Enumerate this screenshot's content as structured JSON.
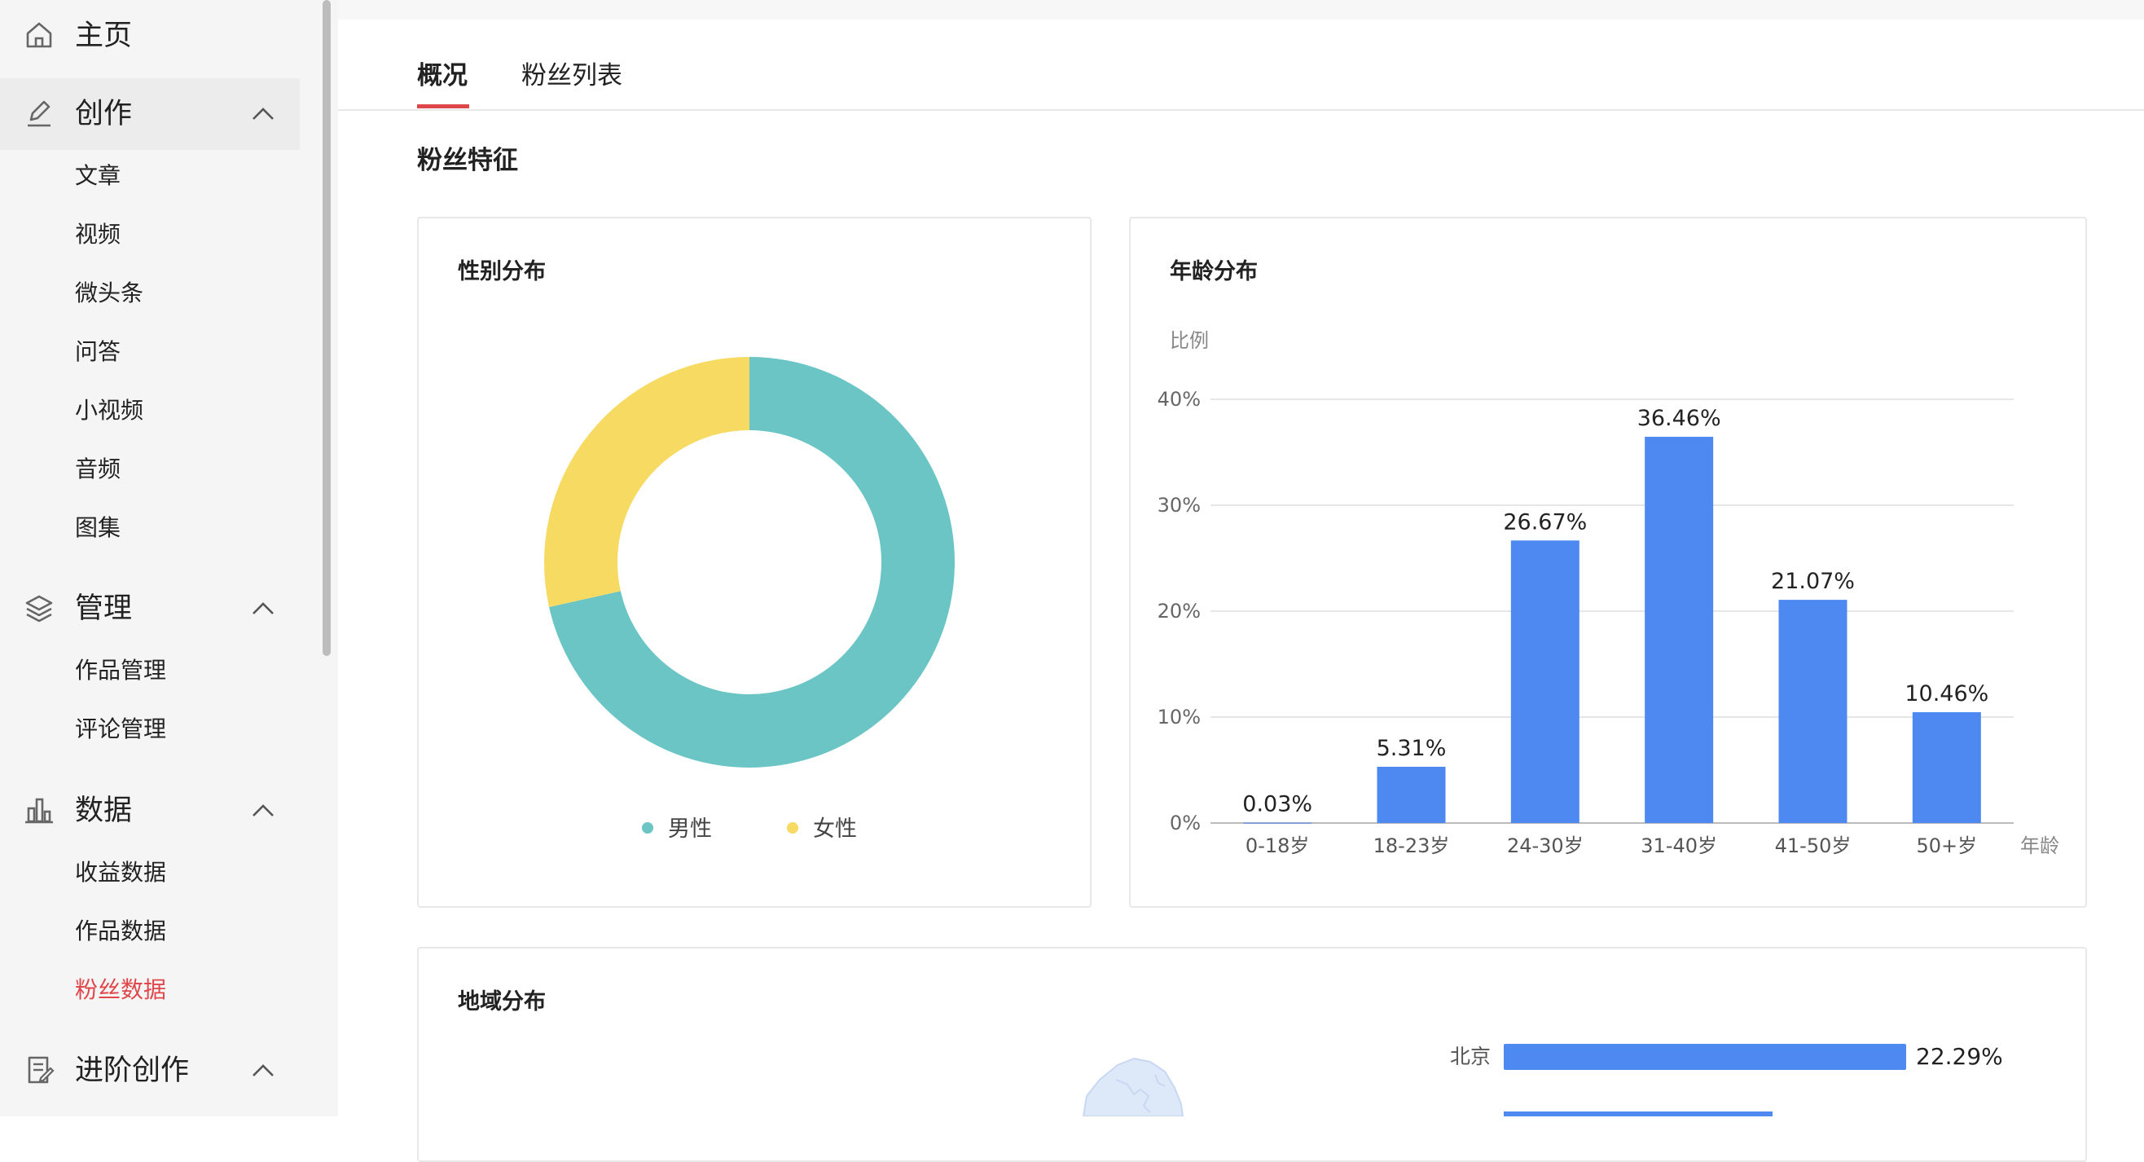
{
  "sidebar": {
    "home": {
      "label": "主页",
      "icon": "home-icon"
    },
    "groups": [
      {
        "label": "创作",
        "icon": "edit-icon",
        "items": [
          "文章",
          "视频",
          "微头条",
          "问答",
          "小视频",
          "音频",
          "图集"
        ]
      },
      {
        "label": "管理",
        "icon": "layers-icon",
        "items": [
          "作品管理",
          "评论管理"
        ]
      },
      {
        "label": "数据",
        "icon": "bar-chart-icon",
        "items": [
          "收益数据",
          "作品数据",
          "粉丝数据"
        ]
      },
      {
        "label": "进阶创作",
        "icon": "document-icon",
        "items": []
      }
    ],
    "active_item": "粉丝数据"
  },
  "tabs": [
    "概况",
    "粉丝列表"
  ],
  "active_tab": "概况",
  "section_title": "粉丝特征",
  "gender_card": {
    "title": "性别分布"
  },
  "age_card": {
    "title": "年龄分布"
  },
  "region_card": {
    "title": "地域分布"
  },
  "colors": {
    "male": "#6cc5c5",
    "female": "#f7da62",
    "bar": "#4e89f2",
    "accent": "#e0474b"
  },
  "chart_data": [
    {
      "type": "pie",
      "title": "性别分布",
      "labels": [
        "男性",
        "女性"
      ],
      "values": [
        71.5,
        28.5
      ],
      "donut": true,
      "legend": "bottom"
    },
    {
      "type": "bar",
      "title": "年龄分布",
      "categories": [
        "0-18岁",
        "18-23岁",
        "24-30岁",
        "31-40岁",
        "41-50岁",
        "50+岁"
      ],
      "values": [
        0.03,
        5.31,
        26.67,
        36.46,
        21.07,
        10.46
      ],
      "value_labels": [
        "0.03%",
        "5.31%",
        "26.67%",
        "36.46%",
        "21.07%",
        "10.46%"
      ],
      "ylabel": "比例",
      "xlabel": "年龄",
      "yticks": [
        "0%",
        "10%",
        "20%",
        "30%",
        "40%"
      ],
      "ylim": [
        0,
        40
      ],
      "grid": true
    },
    {
      "type": "bar",
      "title": "地域分布",
      "orientation": "horizontal",
      "categories": [
        "北京"
      ],
      "values": [
        22.29
      ],
      "value_labels": [
        "22.29%"
      ]
    }
  ]
}
